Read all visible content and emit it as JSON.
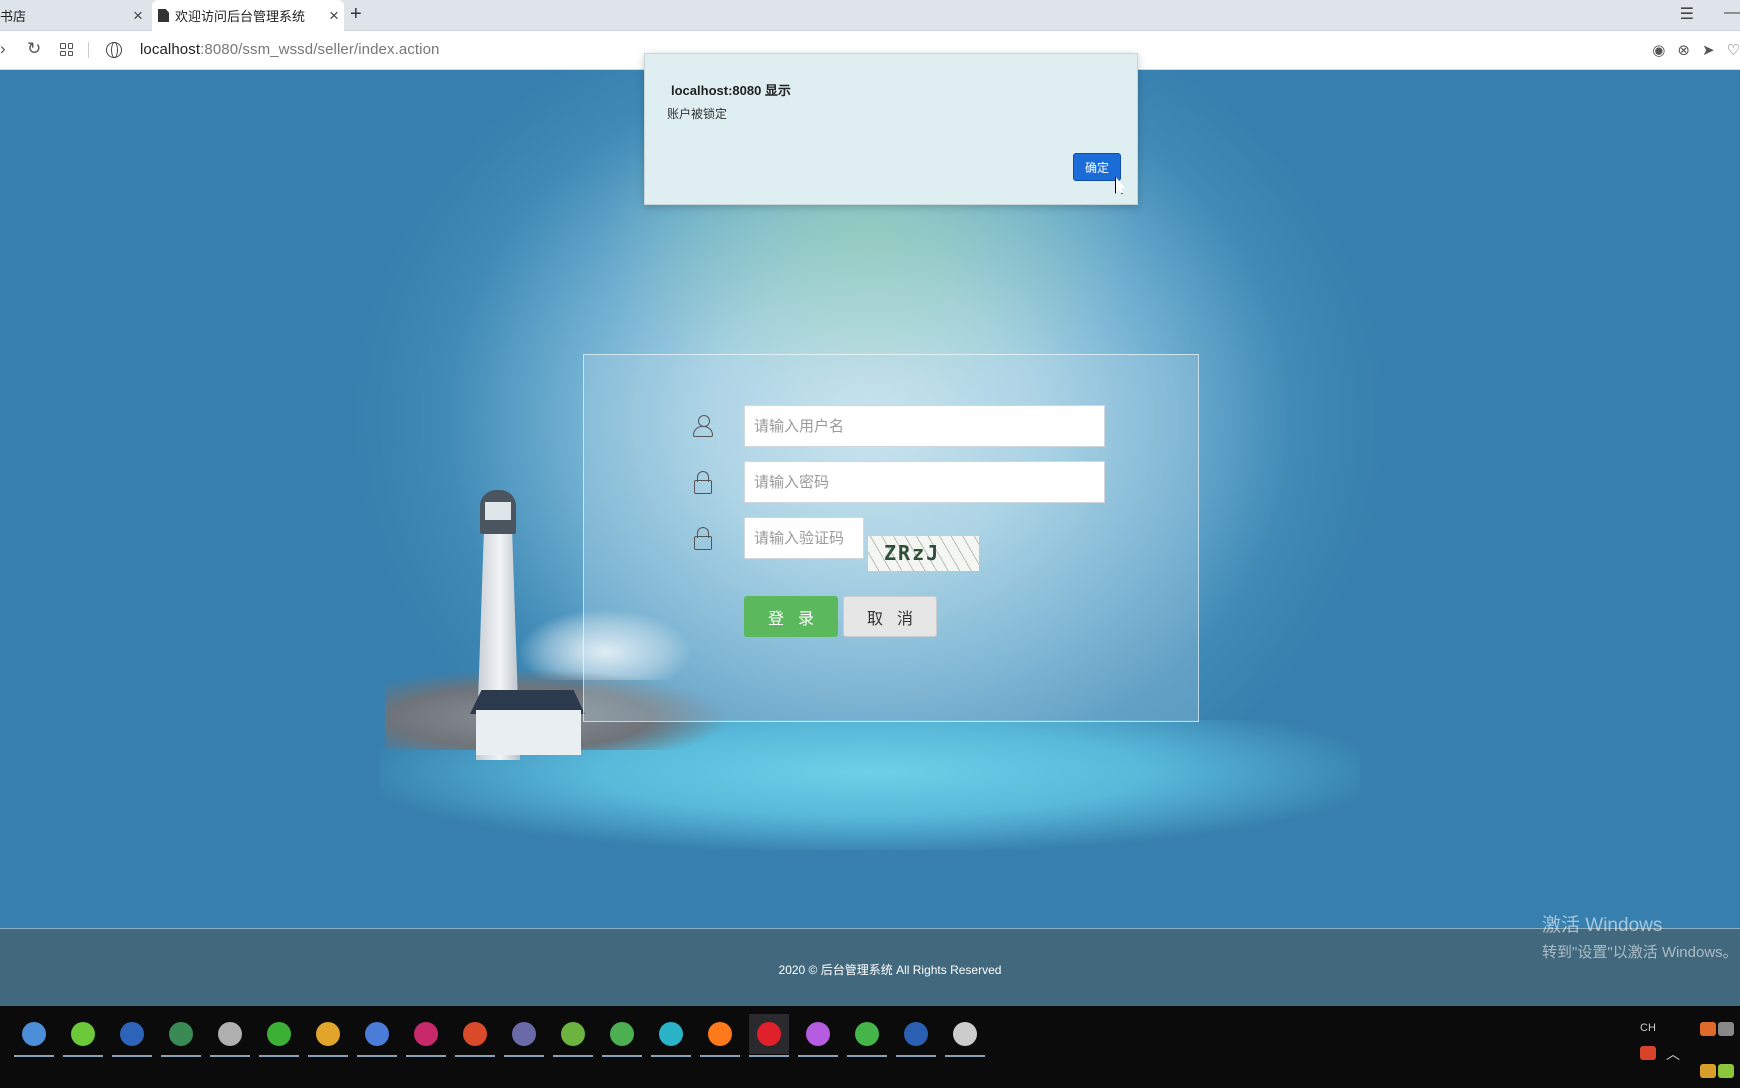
{
  "browser": {
    "tabs": [
      {
        "title": "书店",
        "active": false
      },
      {
        "title": "欢迎访问后台管理系统",
        "active": true
      }
    ],
    "url_host": "localhost",
    "url_rest": ":8080/ssm_wssd/seller/index.action"
  },
  "alert": {
    "title": "localhost:8080 显示",
    "message": "账户被锁定",
    "ok_label": "确定"
  },
  "login": {
    "username_placeholder": "请输入用户名",
    "password_placeholder": "请输入密码",
    "captcha_placeholder": "请输入验证码",
    "captcha_text": "ZRzJ",
    "login_label": "登录",
    "cancel_label": "取消"
  },
  "footer": {
    "text": "2020 © 后台管理系统 All Rights Reserved"
  },
  "watermark": {
    "line1": "激活 Windows",
    "line2": "转到\"设置\"以激活 Windows。"
  },
  "tray": {
    "lang": "CH"
  },
  "taskbar_icons": [
    {
      "name": "browser-globe-icon",
      "color": "#4c8fd8"
    },
    {
      "name": "green-app-icon",
      "color": "#6bc93a"
    },
    {
      "name": "eclipse-icon",
      "color": "#2d63b8"
    },
    {
      "name": "game-icon",
      "color": "#3a8a55"
    },
    {
      "name": "tools-icon",
      "color": "#b0b0b0"
    },
    {
      "name": "wechat-icon",
      "color": "#3cb034"
    },
    {
      "name": "chrome-icon",
      "color": "#e0a52a"
    },
    {
      "name": "chromium-icon",
      "color": "#4a7cd8"
    },
    {
      "name": "intellij-icon",
      "color": "#c62a6a"
    },
    {
      "name": "java-icon",
      "color": "#d84a2a"
    },
    {
      "name": "terminal-icon",
      "color": "#6a6aa8"
    },
    {
      "name": "spring-icon",
      "color": "#6db33f"
    },
    {
      "name": "leaf-icon",
      "color": "#4caf50"
    },
    {
      "name": "edge-icon",
      "color": "#2bb3c8"
    },
    {
      "name": "firefox-icon",
      "color": "#ff7a1a"
    },
    {
      "name": "opera-icon",
      "color": "#e0202a"
    },
    {
      "name": "colorful-icon",
      "color": "#b65ce0"
    },
    {
      "name": "chat-icon",
      "color": "#45b549"
    },
    {
      "name": "word-icon",
      "color": "#2b5fb3"
    },
    {
      "name": "editor-icon",
      "color": "#cccccc"
    }
  ]
}
